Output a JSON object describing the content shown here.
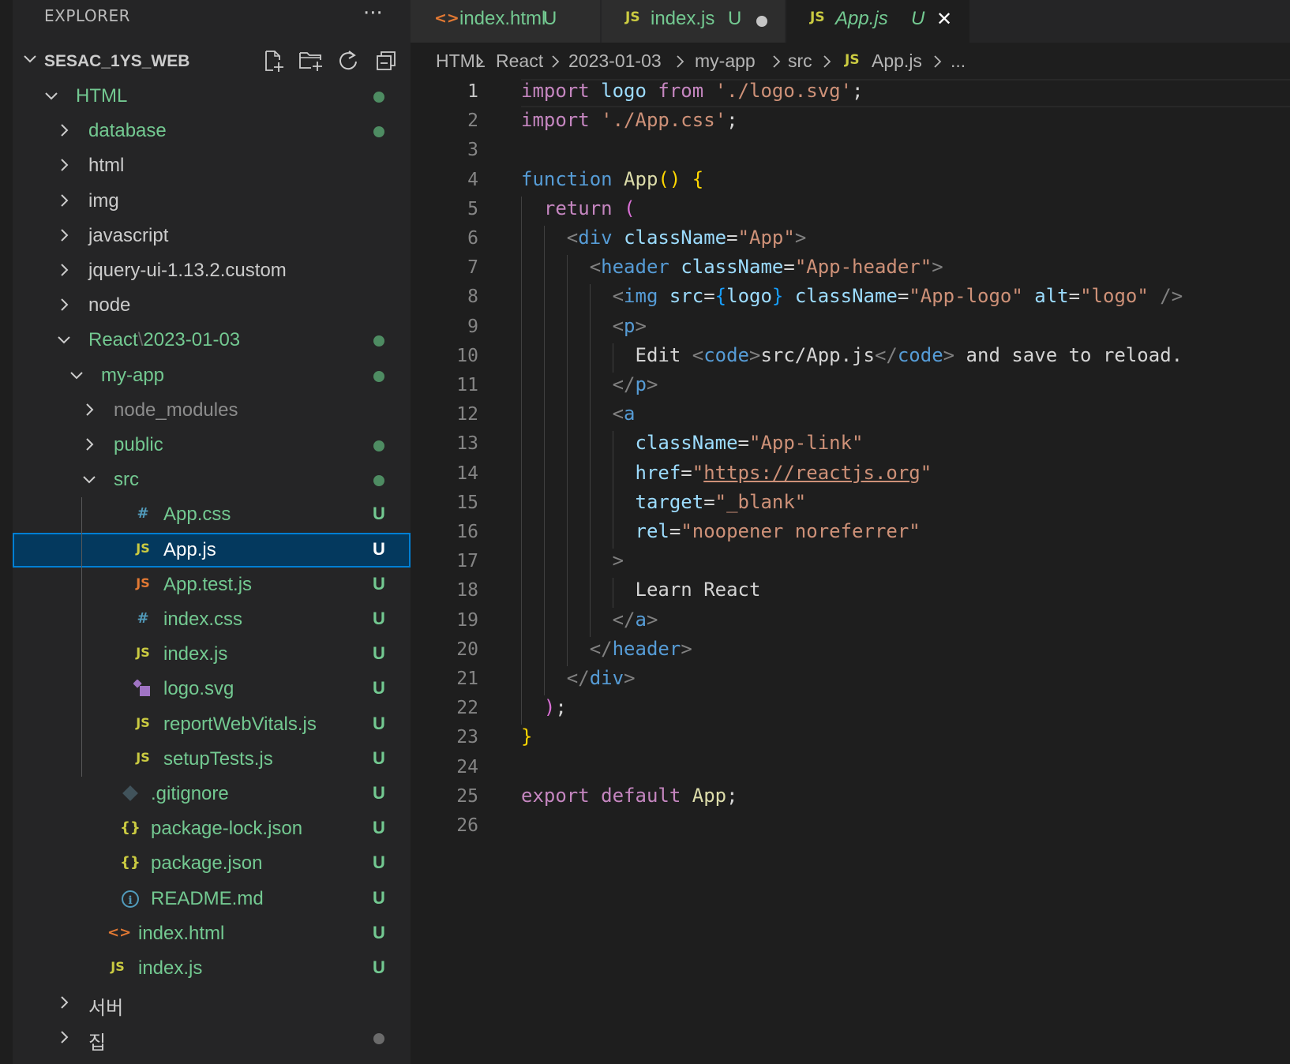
{
  "colors": {
    "git_untracked": "#73c991",
    "modified_dot": "#73c991",
    "folder_text": "#cccccc",
    "selection_bg": "#04395e",
    "selection_border": "#007fd4",
    "js_icon": "#cbcb41",
    "css_icon": "#519aba",
    "html_icon": "#e37933",
    "json_icon": "#cbcb41"
  },
  "sidebar": {
    "title": "EXPLORER",
    "more": "···",
    "root": {
      "label": "SESAC_1YS_WEB"
    },
    "actions": [
      "new-file-icon",
      "new-folder-icon",
      "refresh-icon",
      "collapse-all-icon"
    ],
    "tree": [
      {
        "label": "HTML",
        "type": "folder",
        "open": true,
        "depth": 0,
        "color": "green",
        "decoration": "dot-green"
      },
      {
        "label": "database",
        "type": "folder",
        "open": false,
        "depth": 1,
        "color": "green",
        "decoration": "dot-green"
      },
      {
        "label": "html",
        "type": "folder",
        "open": false,
        "depth": 1,
        "color": "white",
        "decoration": ""
      },
      {
        "label": "img",
        "type": "folder",
        "open": false,
        "depth": 1,
        "color": "white",
        "decoration": ""
      },
      {
        "label": "javascript",
        "type": "folder",
        "open": false,
        "depth": 1,
        "color": "white",
        "decoration": ""
      },
      {
        "label": "jquery-ui-1.13.2.custom",
        "type": "folder",
        "open": false,
        "depth": 1,
        "color": "white",
        "decoration": ""
      },
      {
        "label": "node",
        "type": "folder",
        "open": false,
        "depth": 1,
        "color": "white",
        "decoration": ""
      },
      {
        "label": "React",
        "label2": "2023-01-03",
        "sep": "\\",
        "type": "folder",
        "open": true,
        "depth": 1,
        "color": "green",
        "decoration": "dot-green"
      },
      {
        "label": "my-app",
        "type": "folder",
        "open": true,
        "depth": 2,
        "color": "green",
        "decoration": "dot-green"
      },
      {
        "label": "node_modules",
        "type": "folder",
        "open": false,
        "depth": 3,
        "color": "grey",
        "decoration": ""
      },
      {
        "label": "public",
        "type": "folder",
        "open": false,
        "depth": 3,
        "color": "green",
        "decoration": "dot-green"
      },
      {
        "label": "src",
        "type": "folder",
        "open": true,
        "depth": 3,
        "color": "green",
        "decoration": "dot-green"
      },
      {
        "label": "App.css",
        "type": "file",
        "icon": "#",
        "icon_name": "css-file-icon",
        "icon_color": "#519aba",
        "depth": 4,
        "color": "green",
        "decoration": "U"
      },
      {
        "label": "App.js",
        "type": "file",
        "icon": "JS",
        "icon_name": "js-file-icon",
        "icon_color": "#cbcb41",
        "depth": 4,
        "color": "white",
        "decoration": "U",
        "selected": true
      },
      {
        "label": "App.test.js",
        "type": "file",
        "icon": "JS",
        "icon_name": "js-test-file-icon",
        "icon_color": "#e37933",
        "depth": 4,
        "color": "green",
        "decoration": "U"
      },
      {
        "label": "index.css",
        "type": "file",
        "icon": "#",
        "icon_name": "css-file-icon",
        "icon_color": "#519aba",
        "depth": 4,
        "color": "green",
        "decoration": "U"
      },
      {
        "label": "index.js",
        "type": "file",
        "icon": "JS",
        "icon_name": "js-file-icon",
        "icon_color": "#cbcb41",
        "depth": 4,
        "color": "green",
        "decoration": "U"
      },
      {
        "label": "logo.svg",
        "type": "file",
        "icon": "svg",
        "icon_name": "svg-file-icon",
        "icon_color": "#a074c4",
        "depth": 4,
        "color": "green",
        "decoration": "U"
      },
      {
        "label": "reportWebVitals.js",
        "type": "file",
        "icon": "JS",
        "icon_name": "js-file-icon",
        "icon_color": "#cbcb41",
        "depth": 4,
        "color": "green",
        "decoration": "U"
      },
      {
        "label": "setupTests.js",
        "type": "file",
        "icon": "JS",
        "icon_name": "js-file-icon",
        "icon_color": "#cbcb41",
        "depth": 4,
        "color": "green",
        "decoration": "U"
      },
      {
        "label": ".gitignore",
        "type": "file",
        "icon": "git",
        "icon_name": "git-file-icon",
        "icon_color": "#41535b",
        "depth": 3,
        "color": "green",
        "decoration": "U"
      },
      {
        "label": "package-lock.json",
        "type": "file",
        "icon": "{}",
        "icon_name": "json-file-icon",
        "icon_color": "#cbcb41",
        "depth": 3,
        "color": "green",
        "decoration": "U"
      },
      {
        "label": "package.json",
        "type": "file",
        "icon": "{}",
        "icon_name": "json-file-icon",
        "icon_color": "#cbcb41",
        "depth": 3,
        "color": "green",
        "decoration": "U"
      },
      {
        "label": "README.md",
        "type": "file",
        "icon": "i",
        "icon_name": "info-file-icon",
        "icon_color": "#519aba",
        "depth": 3,
        "color": "green",
        "decoration": "U"
      },
      {
        "label": "index.html",
        "type": "file",
        "icon": "<>",
        "icon_name": "html-file-icon",
        "icon_color": "#e37933",
        "depth": 2,
        "color": "green",
        "decoration": "U"
      },
      {
        "label": "index.js",
        "type": "file",
        "icon": "JS",
        "icon_name": "js-file-icon",
        "icon_color": "#cbcb41",
        "depth": 2,
        "color": "green",
        "decoration": "U"
      },
      {
        "label": "서버",
        "type": "folder",
        "open": false,
        "depth": 1,
        "color": "white",
        "decoration": ""
      },
      {
        "label": "집",
        "type": "folder",
        "open": false,
        "depth": 1,
        "color": "white",
        "decoration": "dot-grey"
      }
    ]
  },
  "tabs": [
    {
      "label": "index.html",
      "icon": "<>",
      "icon_name": "html-file-icon",
      "icon_color": "#e37933",
      "badge": "U",
      "active": false,
      "dirty": false
    },
    {
      "label": "index.js",
      "icon": "JS",
      "icon_name": "js-file-icon",
      "icon_color": "#cbcb41",
      "badge": "U",
      "active": false,
      "dirty": true
    },
    {
      "label": "App.js",
      "icon": "JS",
      "icon_name": "js-file-icon",
      "icon_color": "#cbcb41",
      "badge": "U",
      "active": true,
      "close": "✕"
    }
  ],
  "breadcrumb": {
    "items": [
      "HTML",
      "React",
      "2023-01-03",
      "my-app",
      "src"
    ],
    "file_icon": "JS",
    "file": "App.js",
    "ellipsis": "..."
  },
  "editor": {
    "active_line": 1,
    "lines": [
      [
        [
          "kw-purple",
          "import"
        ],
        [
          "txt",
          " "
        ],
        [
          "var",
          "logo"
        ],
        [
          "txt",
          " "
        ],
        [
          "kw-purple",
          "from"
        ],
        [
          "txt",
          " "
        ],
        [
          "str",
          "'./logo.svg'"
        ],
        [
          "txt",
          ";"
        ]
      ],
      [
        [
          "kw-purple",
          "import"
        ],
        [
          "txt",
          " "
        ],
        [
          "str",
          "'./App.css'"
        ],
        [
          "txt",
          ";"
        ]
      ],
      [],
      [
        [
          "kw-blue",
          "function"
        ],
        [
          "txt",
          " "
        ],
        [
          "fn",
          "App"
        ],
        [
          "br-gold",
          "()"
        ],
        [
          "txt",
          " "
        ],
        [
          "br-gold",
          "{"
        ]
      ],
      [
        [
          "txt",
          "  "
        ],
        [
          "kw-purple",
          "return"
        ],
        [
          "txt",
          " "
        ],
        [
          "br-purple",
          "("
        ]
      ],
      [
        [
          "txt",
          "    "
        ],
        [
          "tagc",
          "<"
        ],
        [
          "tagn",
          "div"
        ],
        [
          "txt",
          " "
        ],
        [
          "attr",
          "className"
        ],
        [
          "txt",
          "="
        ],
        [
          "str",
          "\"App\""
        ],
        [
          "tagc",
          ">"
        ]
      ],
      [
        [
          "txt",
          "      "
        ],
        [
          "tagc",
          "<"
        ],
        [
          "tagn",
          "header"
        ],
        [
          "txt",
          " "
        ],
        [
          "attr",
          "className"
        ],
        [
          "txt",
          "="
        ],
        [
          "str",
          "\"App-header\""
        ],
        [
          "tagc",
          ">"
        ]
      ],
      [
        [
          "txt",
          "        "
        ],
        [
          "tagc",
          "<"
        ],
        [
          "tagn",
          "img"
        ],
        [
          "txt",
          " "
        ],
        [
          "attr",
          "src"
        ],
        [
          "txt",
          "="
        ],
        [
          "br-blue",
          "{"
        ],
        [
          "var",
          "logo"
        ],
        [
          "br-blue",
          "}"
        ],
        [
          "txt",
          " "
        ],
        [
          "attr",
          "className"
        ],
        [
          "txt",
          "="
        ],
        [
          "str",
          "\"App-logo\""
        ],
        [
          "txt",
          " "
        ],
        [
          "attr",
          "alt"
        ],
        [
          "txt",
          "="
        ],
        [
          "str",
          "\"logo\""
        ],
        [
          "txt",
          " "
        ],
        [
          "tagc",
          "/>"
        ]
      ],
      [
        [
          "txt",
          "        "
        ],
        [
          "tagc",
          "<"
        ],
        [
          "tagn",
          "p"
        ],
        [
          "tagc",
          ">"
        ]
      ],
      [
        [
          "txt",
          "          "
        ],
        [
          "txt",
          "Edit "
        ],
        [
          "tagc",
          "<"
        ],
        [
          "tagn",
          "code"
        ],
        [
          "tagc",
          ">"
        ],
        [
          "txt",
          "src/App.js"
        ],
        [
          "tagc",
          "</"
        ],
        [
          "tagn",
          "code"
        ],
        [
          "tagc",
          ">"
        ],
        [
          "txt",
          " and save to reload."
        ]
      ],
      [
        [
          "txt",
          "        "
        ],
        [
          "tagc",
          "</"
        ],
        [
          "tagn",
          "p"
        ],
        [
          "tagc",
          ">"
        ]
      ],
      [
        [
          "txt",
          "        "
        ],
        [
          "tagc",
          "<"
        ],
        [
          "tagn",
          "a"
        ]
      ],
      [
        [
          "txt",
          "          "
        ],
        [
          "attr",
          "className"
        ],
        [
          "txt",
          "="
        ],
        [
          "str",
          "\"App-link\""
        ]
      ],
      [
        [
          "txt",
          "          "
        ],
        [
          "attr",
          "href"
        ],
        [
          "txt",
          "="
        ],
        [
          "str",
          "\""
        ],
        [
          "url",
          "https://reactjs.org"
        ],
        [
          "str",
          "\""
        ]
      ],
      [
        [
          "txt",
          "          "
        ],
        [
          "attr",
          "target"
        ],
        [
          "txt",
          "="
        ],
        [
          "str",
          "\"_blank\""
        ]
      ],
      [
        [
          "txt",
          "          "
        ],
        [
          "attr",
          "rel"
        ],
        [
          "txt",
          "="
        ],
        [
          "str",
          "\"noopener noreferrer\""
        ]
      ],
      [
        [
          "txt",
          "        "
        ],
        [
          "tagc",
          ">"
        ]
      ],
      [
        [
          "txt",
          "          "
        ],
        [
          "txt",
          "Learn React"
        ]
      ],
      [
        [
          "txt",
          "        "
        ],
        [
          "tagc",
          "</"
        ],
        [
          "tagn",
          "a"
        ],
        [
          "tagc",
          ">"
        ]
      ],
      [
        [
          "txt",
          "      "
        ],
        [
          "tagc",
          "</"
        ],
        [
          "tagn",
          "header"
        ],
        [
          "tagc",
          ">"
        ]
      ],
      [
        [
          "txt",
          "    "
        ],
        [
          "tagc",
          "</"
        ],
        [
          "tagn",
          "div"
        ],
        [
          "tagc",
          ">"
        ]
      ],
      [
        [
          "txt",
          "  "
        ],
        [
          "br-purple",
          ")"
        ],
        [
          "txt",
          ";"
        ]
      ],
      [
        [
          "br-gold",
          "}"
        ]
      ],
      [],
      [
        [
          "kw-purple",
          "export"
        ],
        [
          "txt",
          " "
        ],
        [
          "kw-purple",
          "default"
        ],
        [
          "txt",
          " "
        ],
        [
          "fn",
          "App"
        ],
        [
          "txt",
          ";"
        ]
      ],
      []
    ]
  }
}
